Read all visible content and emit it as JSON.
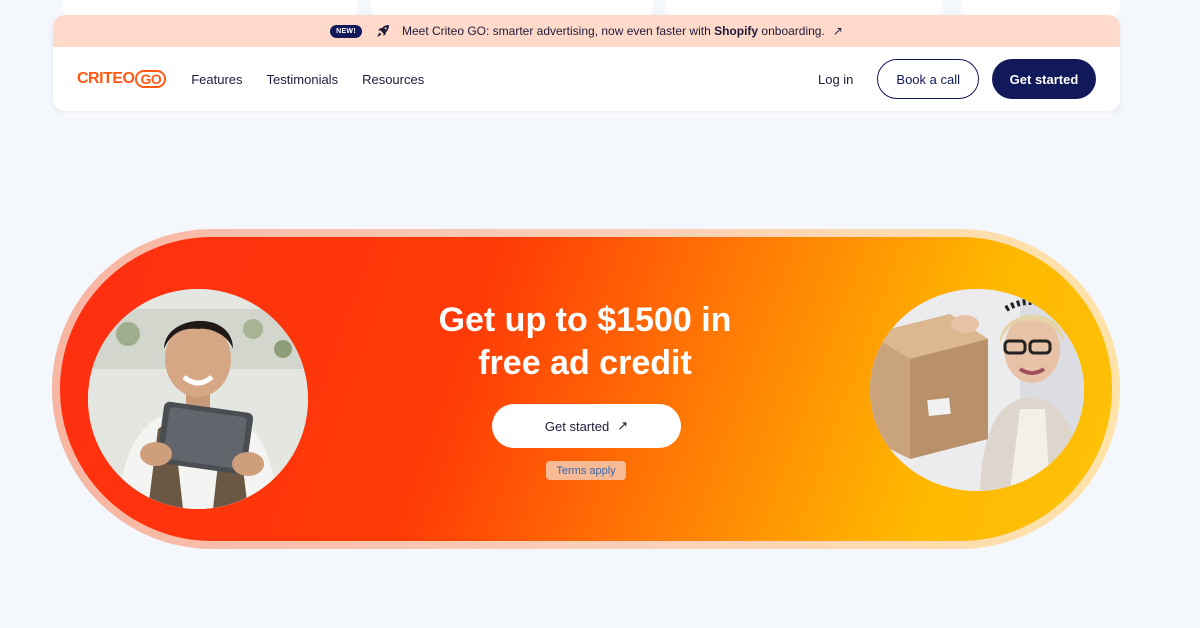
{
  "announcement": {
    "badge": "NEW!",
    "text_before": "Meet Criteo GO: smarter advertising, now even faster with ",
    "text_bold": "Shopify",
    "text_after": " onboarding.",
    "arrow": "↗",
    "icon": "rocket-icon"
  },
  "nav": {
    "logo_text": "CRITEO",
    "logo_suffix": "GO",
    "links": [
      "Features",
      "Testimonials",
      "Resources"
    ],
    "login": "Log in",
    "book_call": "Book a call",
    "get_started": "Get started"
  },
  "hero": {
    "headline_line1": "Get up to $1500 in",
    "headline_line2": "free ad credit",
    "cta_label": "Get started",
    "cta_arrow": "↗",
    "terms": "Terms apply"
  },
  "colors": {
    "accent": "#ff5a14",
    "navy": "#11195a",
    "banner": "#ffd9c9",
    "gradient_start": "#ff2e12",
    "gradient_end": "#ffc20a"
  }
}
